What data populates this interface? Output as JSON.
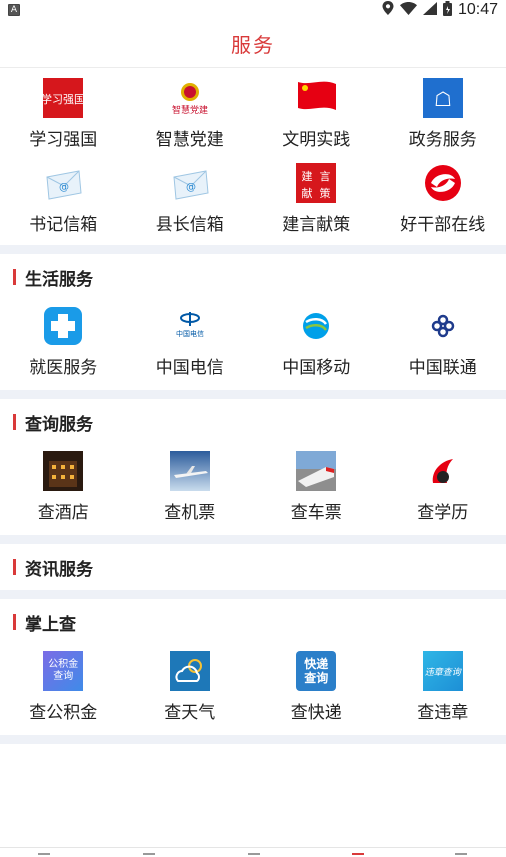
{
  "status_bar": {
    "left_badge": "A",
    "time": "10:47",
    "icons": [
      "location-icon",
      "wifi-icon",
      "signal-icon",
      "battery-icon"
    ]
  },
  "header": {
    "title": "服务"
  },
  "top_services": [
    {
      "label": "学习强国",
      "icon": "xuexi-qiangguo-icon",
      "color": "#d6171c"
    },
    {
      "label": "智慧党建",
      "icon": "party-emblem-icon",
      "color": "#c8102e"
    },
    {
      "label": "文明实践",
      "icon": "red-flag-icon",
      "color": "#e60012"
    },
    {
      "label": "政务服务",
      "icon": "government-service-icon",
      "color": "#1f6fcf"
    },
    {
      "label": "书记信箱",
      "icon": "mail-envelope-icon",
      "color": "#4aa3df"
    },
    {
      "label": "县长信箱",
      "icon": "mail-envelope-icon",
      "color": "#4aa3df"
    },
    {
      "label": "建言献策",
      "icon": "suggestion-icon",
      "color": "#d6171c",
      "icon_text": [
        "建",
        "言",
        "献",
        "策"
      ]
    },
    {
      "label": "好干部在线",
      "icon": "cadre-online-icon",
      "color": "#e60012"
    }
  ],
  "sections": {
    "life": {
      "title": "生活服务",
      "items": [
        {
          "label": "就医服务",
          "icon": "medical-cross-icon",
          "color": "#1a9be8"
        },
        {
          "label": "中国电信",
          "icon": "china-telecom-icon",
          "color": "#0058a6"
        },
        {
          "label": "中国移动",
          "icon": "china-mobile-icon",
          "color": "#00a0e9"
        },
        {
          "label": "中国联通",
          "icon": "china-unicom-icon",
          "color": "#1f3b8c"
        }
      ]
    },
    "query": {
      "title": "查询服务",
      "items": [
        {
          "label": "查酒店",
          "icon": "hotel-photo-icon"
        },
        {
          "label": "查机票",
          "icon": "airplane-photo-icon"
        },
        {
          "label": "查车票",
          "icon": "train-photo-icon"
        },
        {
          "label": "查学历",
          "icon": "education-logo-icon"
        }
      ]
    },
    "news": {
      "title": "资讯服务"
    },
    "palm": {
      "title": "掌上查",
      "items": [
        {
          "label": "查公积金",
          "icon": "housing-fund-icon",
          "icon_text": "公积金查询"
        },
        {
          "label": "查天气",
          "icon": "weather-icon"
        },
        {
          "label": "查快递",
          "icon": "express-query-icon",
          "icon_text": "快递查询"
        },
        {
          "label": "查违章",
          "icon": "violation-query-icon",
          "icon_text": "违章查询"
        }
      ]
    }
  }
}
